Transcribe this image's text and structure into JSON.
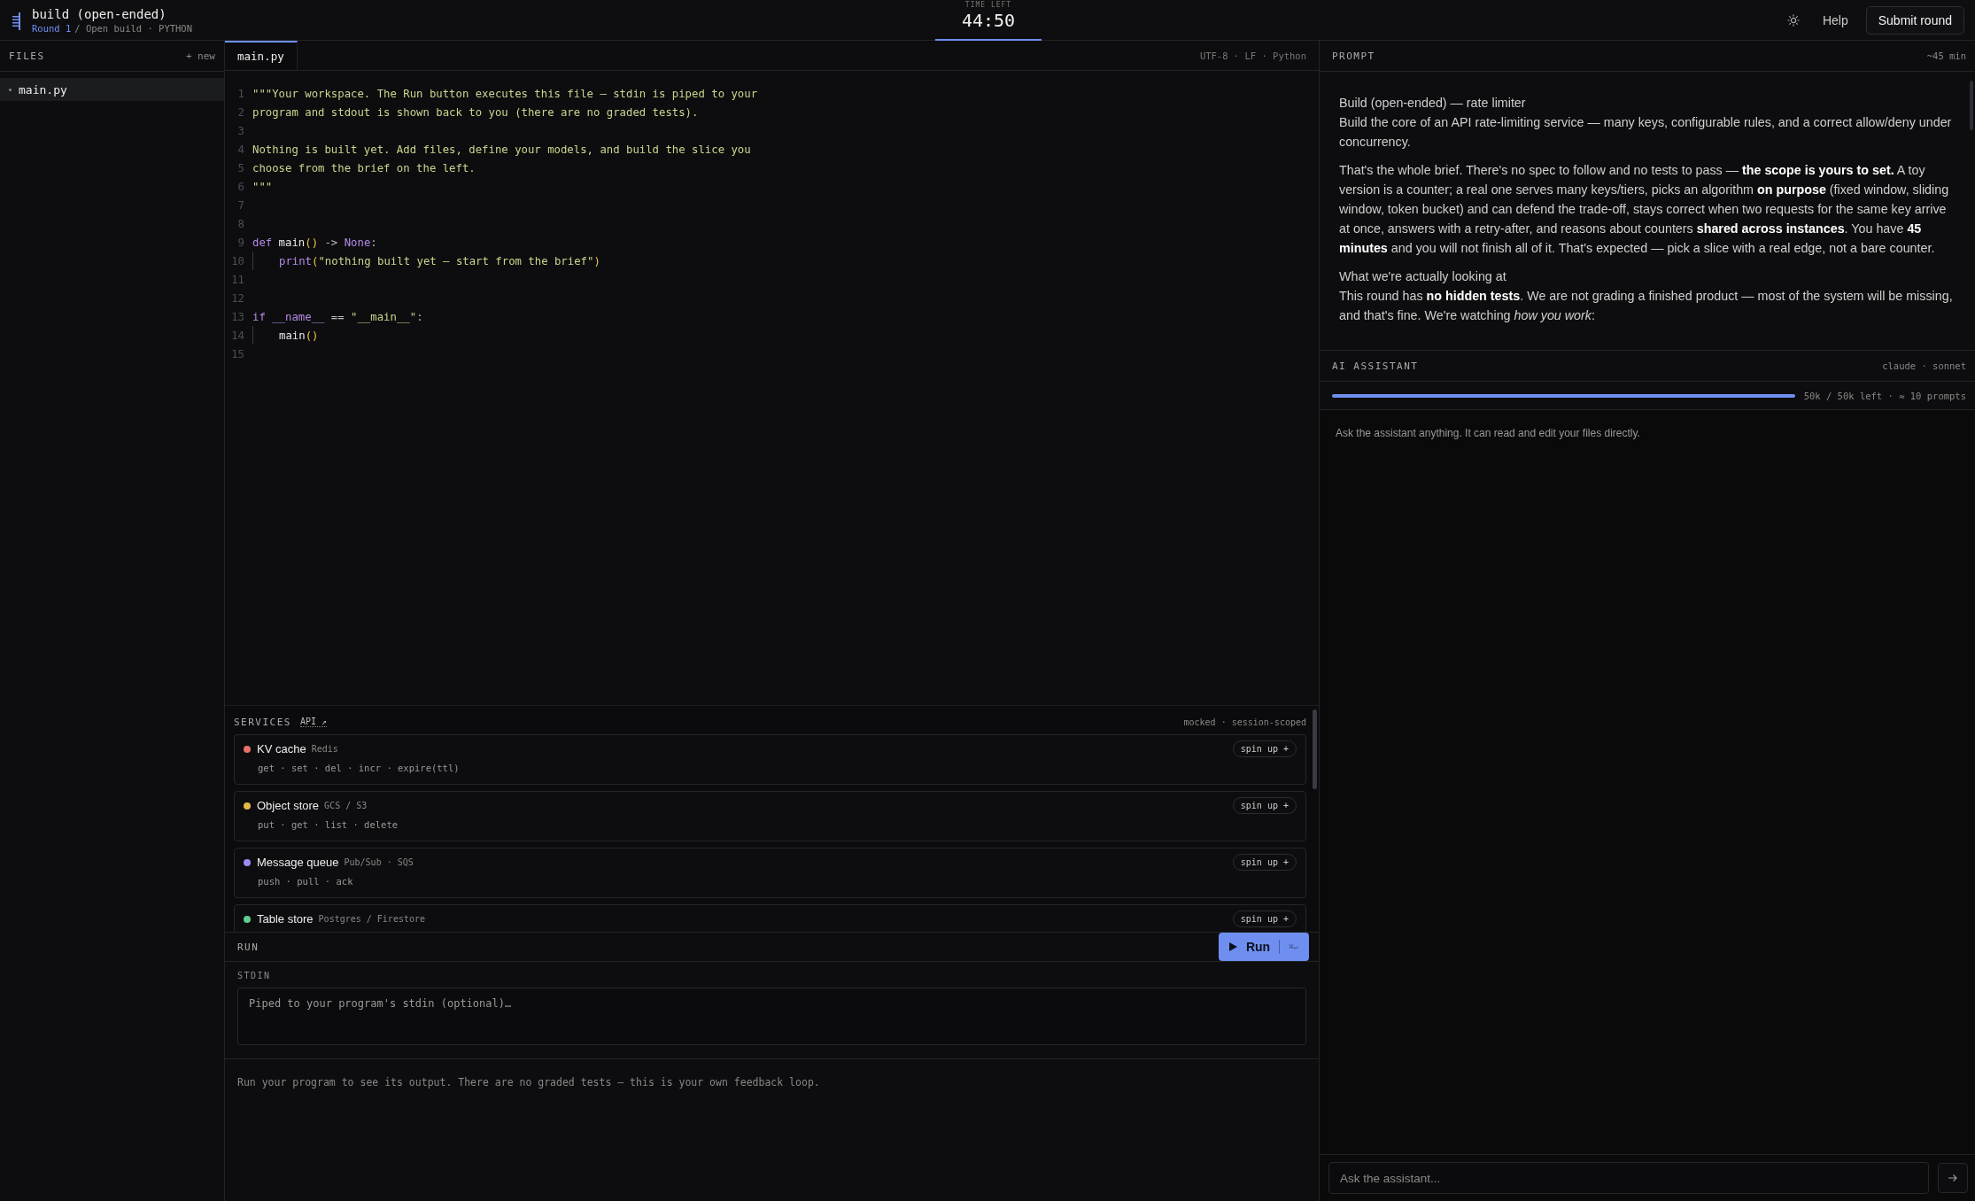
{
  "header": {
    "title": "build (open-ended)",
    "round": "Round 1",
    "path": "/ Open build · PYTHON",
    "timer_label": "TIME LEFT",
    "timer": "44:50",
    "help": "Help",
    "submit": "Submit round"
  },
  "files": {
    "title": "FILES",
    "new": "+ new",
    "items": [
      {
        "name": "main.py",
        "selected": true
      }
    ]
  },
  "editor": {
    "tabs": [
      {
        "label": "main.py",
        "selected": true
      }
    ],
    "status": "UTF-8 · LF · Python",
    "lines": [
      {
        "n": "1",
        "indented": false,
        "tokens": [
          {
            "t": "\"\"\"Your workspace. The Run button executes this file — stdin is piped to your",
            "kind": "string"
          }
        ]
      },
      {
        "n": "2",
        "indented": false,
        "tokens": [
          {
            "t": "program and stdout is shown back to you (there are no graded tests).",
            "kind": "string"
          }
        ]
      },
      {
        "n": "3",
        "indented": false
      },
      {
        "n": "4",
        "indented": false,
        "tokens": [
          {
            "t": "Nothing is built yet. Add files, define your models, and build the slice you",
            "kind": "string"
          }
        ]
      },
      {
        "n": "5",
        "indented": false,
        "tokens": [
          {
            "t": "choose from the brief on the left.",
            "kind": "string"
          }
        ]
      },
      {
        "n": "6",
        "indented": false,
        "tokens": [
          {
            "t": "\"\"\"",
            "kind": "string"
          }
        ]
      },
      {
        "n": "7",
        "indented": false
      },
      {
        "n": "8",
        "indented": false
      },
      {
        "n": "9",
        "indented": false,
        "tokens": [
          {
            "t": "def",
            "kind": "keyword"
          },
          {
            "t": " main",
            "kind": "name"
          },
          {
            "t": "()",
            "kind": "paren"
          },
          {
            "t": " -> ",
            "kind": "op"
          },
          {
            "t": "None",
            "kind": "keyword"
          },
          {
            "t": ":",
            "kind": "op"
          }
        ]
      },
      {
        "n": "10",
        "indented": true,
        "tokens": [
          {
            "t": "print",
            "kind": "keyword"
          },
          {
            "t": "(",
            "kind": "paren"
          },
          {
            "t": "\"nothing built yet — start from the brief\"",
            "kind": "string"
          },
          {
            "t": ")",
            "kind": "paren"
          }
        ]
      },
      {
        "n": "11",
        "indented": false
      },
      {
        "n": "12",
        "indented": false
      },
      {
        "n": "13",
        "indented": false,
        "tokens": [
          {
            "t": "if",
            "kind": "keyword"
          },
          {
            "t": " __name__",
            "kind": "keyword"
          },
          {
            "t": " == ",
            "kind": "op"
          },
          {
            "t": "\"__main__\"",
            "kind": "string"
          },
          {
            "t": ":",
            "kind": "op"
          }
        ]
      },
      {
        "n": "14",
        "indented": true,
        "tokens": [
          {
            "t": "main",
            "kind": "name"
          },
          {
            "t": "()",
            "kind": "paren"
          }
        ]
      },
      {
        "n": "15",
        "indented": false
      }
    ]
  },
  "services": {
    "title": "SERVICES",
    "link": "API ↗",
    "note": "mocked · session-scoped",
    "items": [
      {
        "name": "KV cache",
        "tech": "Redis",
        "ops": "get · set · del · incr · expire(ttl)",
        "color": "#e8716a",
        "action": "spin up +"
      },
      {
        "name": "Object store",
        "tech": "GCS / S3",
        "ops": "put · get · list · delete",
        "color": "#e6b84a",
        "action": "spin up +"
      },
      {
        "name": "Message queue",
        "tech": "Pub/Sub · SQS",
        "ops": "push · pull · ack",
        "color": "#9d8cf0",
        "action": "spin up +"
      },
      {
        "name": "Table store",
        "tech": "Postgres / Firestore",
        "color": "#5fcf8f",
        "action": "spin up +"
      }
    ]
  },
  "run": {
    "title": "RUN",
    "button": "Run",
    "shortcut": "⌘↵",
    "stdin_label": "STDIN",
    "stdin_placeholder": "Piped to your program's stdin (optional)…",
    "output_hint": "Run your program to see its output. There are no graded tests — this is your own feedback loop."
  },
  "prompt": {
    "title": "PROMPT",
    "duration": "~45 min",
    "blocks": [
      {
        "heading": "Build (open-ended) — rate limiter",
        "text": "Build the core of an API rate-limiting service — many keys, configurable rules, and a correct allow/deny under concurrency."
      },
      {
        "text": "That's the whole brief. There's no spec to follow and no tests to pass — **the scope is yours to set.** A toy version is a counter; a real one serves many keys/tiers, picks an algorithm **on purpose** (fixed window, sliding window, token bucket) and can defend the trade-off, stays correct when two requests for the same key arrive at once, answers with a retry-after, and reasons about counters **shared across instances**. You have **45 minutes** and you will not finish all of it. That's expected — pick a slice with a real edge, not a bare counter."
      },
      {
        "heading": "What we're actually looking at",
        "text": "This round has **no hidden tests**. We are not grading a finished product — most of the system will be missing, and that's fine. We're watching *how you work*:"
      }
    ]
  },
  "assistant": {
    "title": "AI ASSISTANT",
    "model": "claude · sonnet",
    "budget": {
      "level": 1,
      "reading": "50k / 50k left · ≈ 10 prompts"
    },
    "hint": "Ask the assistant anything. It can read and edit your files directly.",
    "input_placeholder": "Ask the assistant..."
  }
}
